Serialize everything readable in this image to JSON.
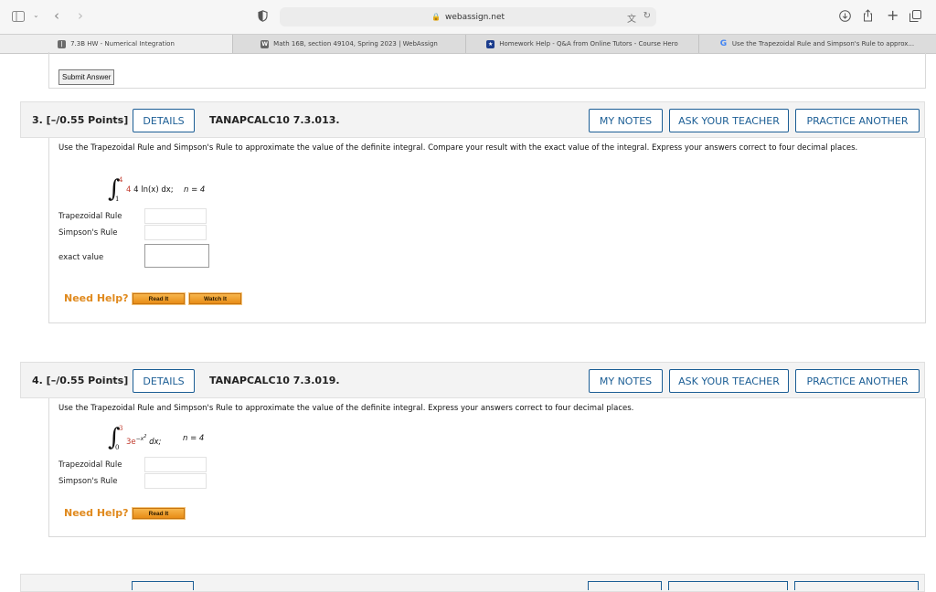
{
  "browser": {
    "address": "webassign.net",
    "tabs": [
      {
        "label": "7.3B HW - Numerical Integration"
      },
      {
        "label": "Math 16B, section 49104, Spring 2023 | WebAssign"
      },
      {
        "label": "Homework Help - Q&A from Online Tutors - Course Hero"
      },
      {
        "label": "Use the Trapezoidal Rule and Simpson's Rule to approx..."
      }
    ]
  },
  "submit_label": "Submit Answer",
  "questions": [
    {
      "number": "3. [–/0.55 Points]",
      "details": "DETAILS",
      "code": "TANAPCALC10 7.3.013.",
      "my_notes": "MY NOTES",
      "ask": "ASK YOUR TEACHER",
      "practice": "PRACTICE ANOTHER",
      "text": "Use the Trapezoidal Rule and Simpson's Rule to approximate the value of the definite integral. Compare your result with the exact value of the integral. Express your answers correct to four decimal places.",
      "integral": {
        "upper": "4",
        "lower": "1",
        "expr": "4 ln(x) dx;",
        "n": "n = 4"
      },
      "fields": [
        "Trapezoidal Rule",
        "Simpson's Rule",
        "exact value"
      ],
      "need_help": "Need Help?",
      "help_buttons": [
        "Read It",
        "Watch It"
      ]
    },
    {
      "number": "4. [–/0.55 Points]",
      "details": "DETAILS",
      "code": "TANAPCALC10 7.3.019.",
      "my_notes": "MY NOTES",
      "ask": "ASK YOUR TEACHER",
      "practice": "PRACTICE ANOTHER",
      "text": "Use the Trapezoidal Rule and Simpson's Rule to approximate the value of the definite integral. Express your answers correct to four decimal places.",
      "integral": {
        "upper": "3",
        "lower": "0",
        "coef": "3e",
        "exp": "−x",
        "exp2": "2",
        "expr": " dx;",
        "n": "n = 4"
      },
      "fields": [
        "Trapezoidal Rule",
        "Simpson's Rule"
      ],
      "need_help": "Need Help?",
      "help_buttons": [
        "Read It"
      ]
    }
  ]
}
